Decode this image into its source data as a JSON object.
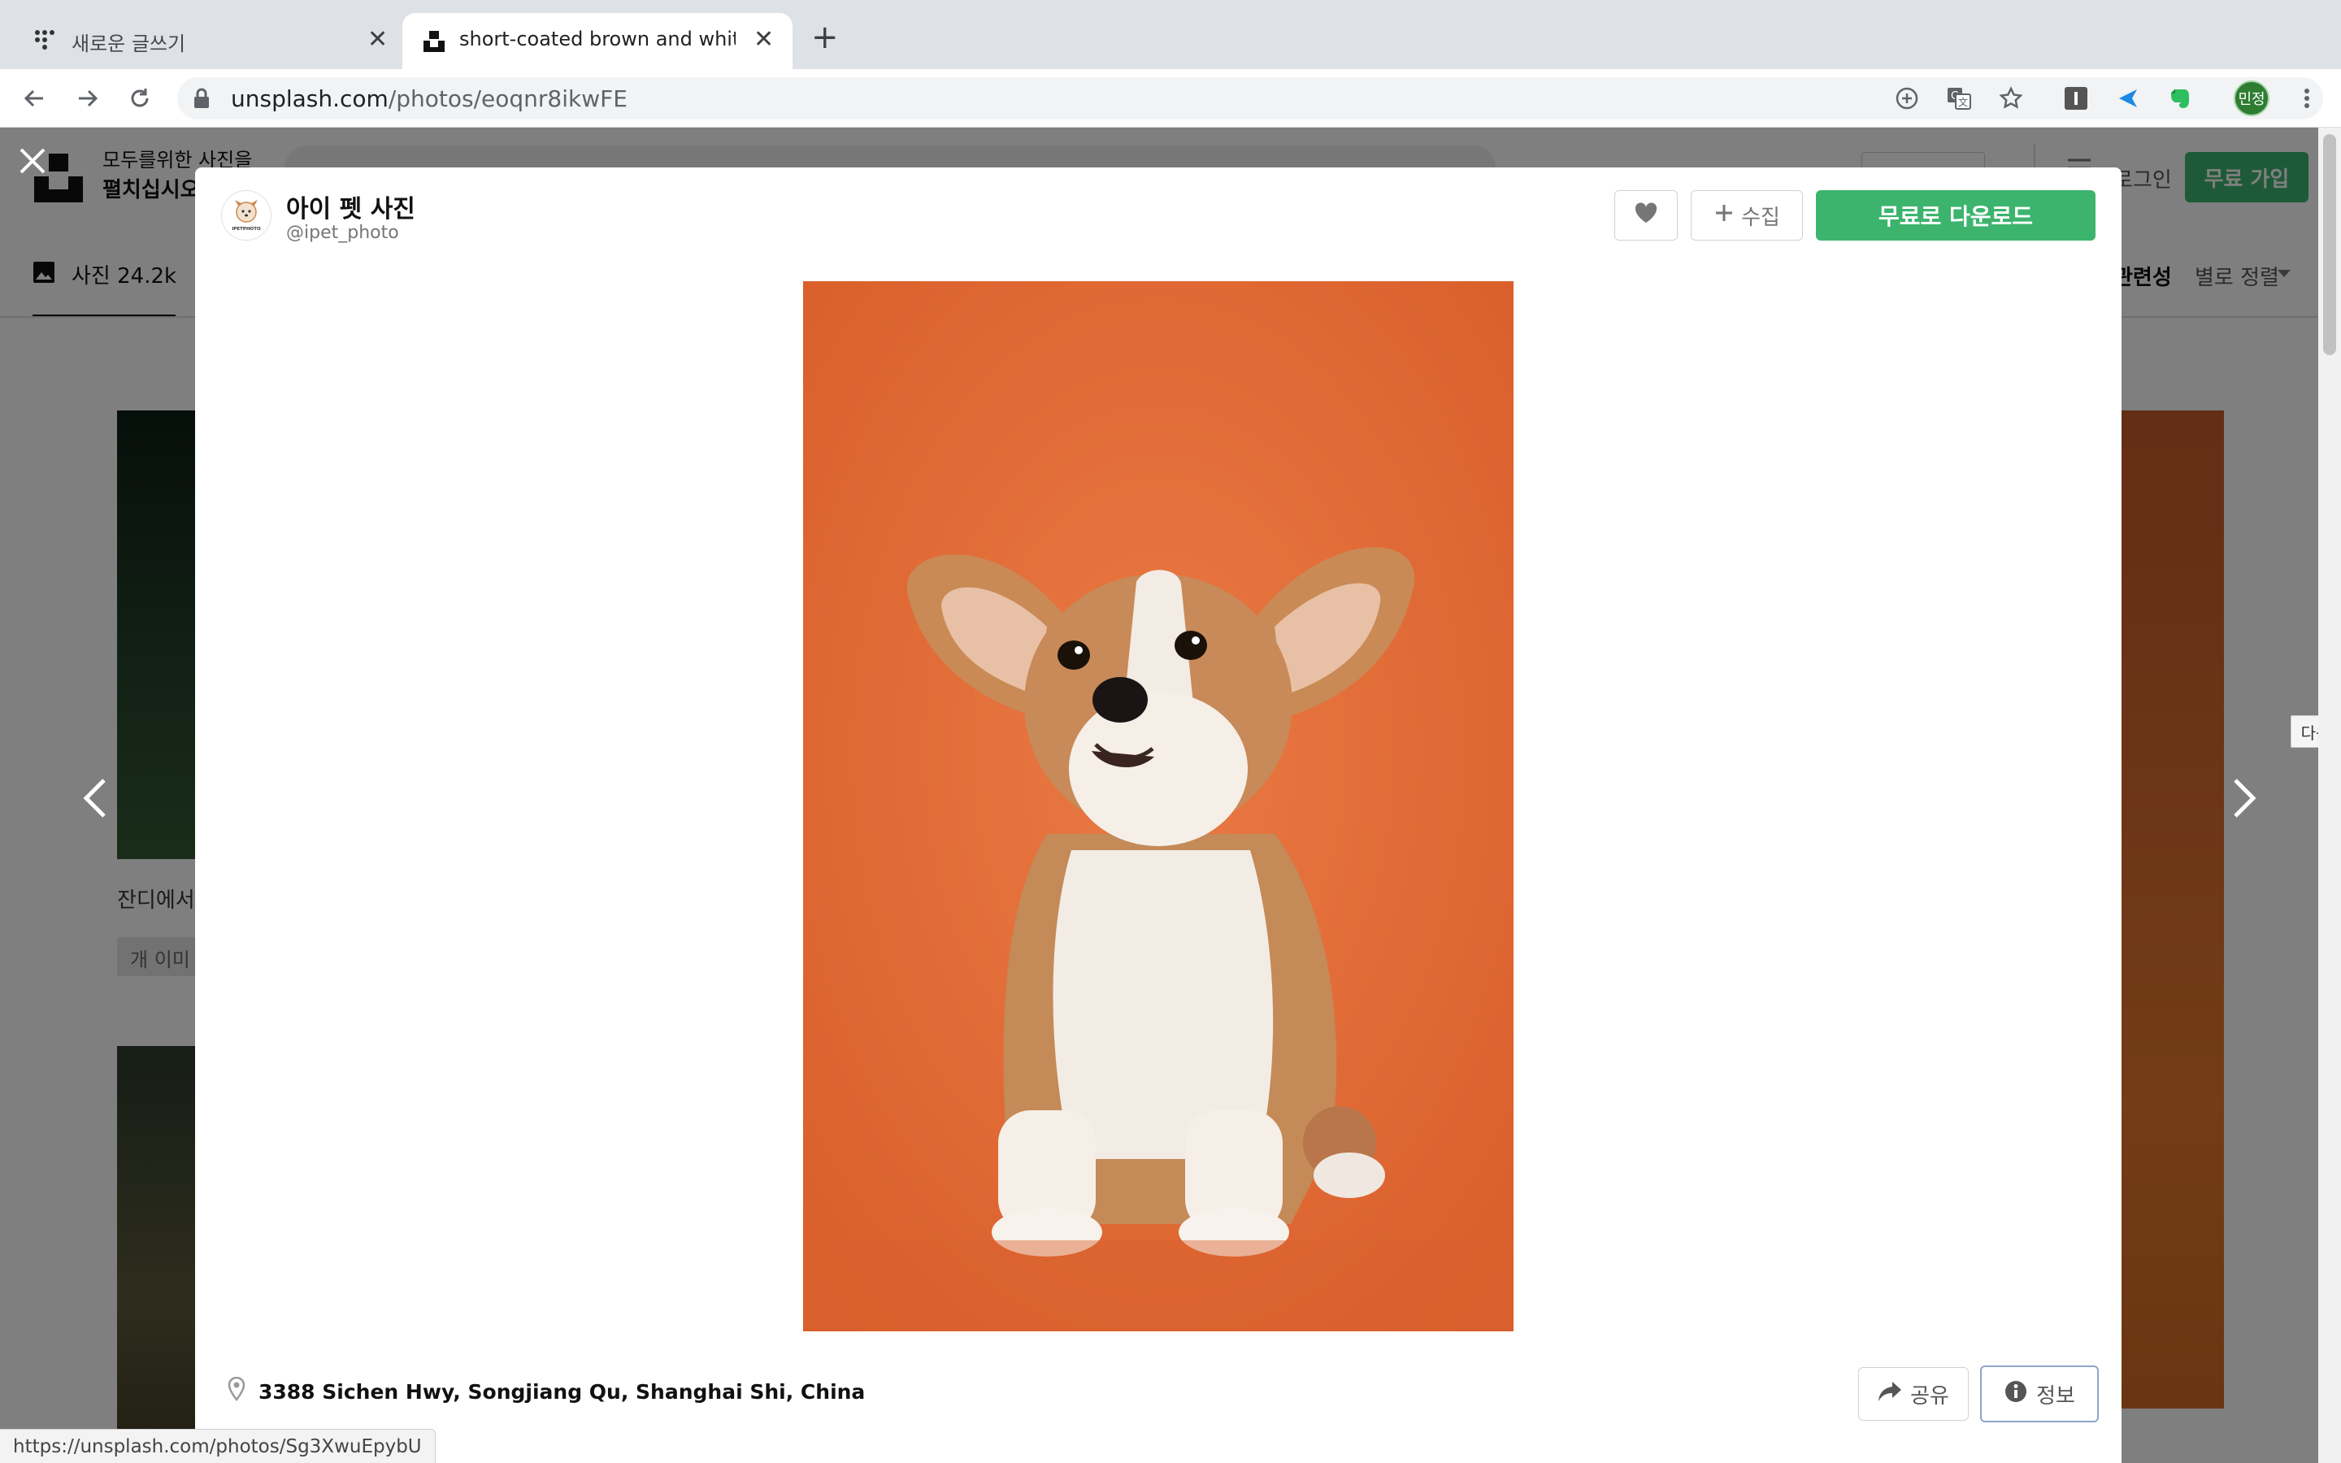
{
  "browser": {
    "tabs": [
      {
        "title": "새로운 글쓰기",
        "active": false
      },
      {
        "title": "short-coated brown and white",
        "active": true
      }
    ],
    "url_host": "unsplash.com",
    "url_path": "/photos/eoqnr8ikwFE",
    "profile_initials": "민정",
    "status_url": "https://unsplash.com/photos/Sg3XwuEpybU"
  },
  "background_page": {
    "tagline_line1": "모두를위한 사진을",
    "tagline_line2": "펼치십시오",
    "login_label": "로그인",
    "signup_label": "무료 가입",
    "photos_tab_label": "사진 24.2k",
    "sort_label": "관련성",
    "sort_suffix": "별로 정렬",
    "caption_partial": "잔디에서",
    "tag_partial": "개 이미"
  },
  "modal": {
    "author_name": "아이 펫 사진",
    "author_handle": "@ipet_photo",
    "avatar_text": "IPETPHOTO",
    "collect_label": "수집",
    "download_label": "무료로 다운로드",
    "location": "3388 Sichen Hwy, Songjiang Qu, Shanghai Shi, China",
    "share_label": "공유",
    "info_label": "정보",
    "next_tooltip": "다음"
  },
  "colors": {
    "download_green": "#3cb46e",
    "photo_background": "#e46a36"
  }
}
